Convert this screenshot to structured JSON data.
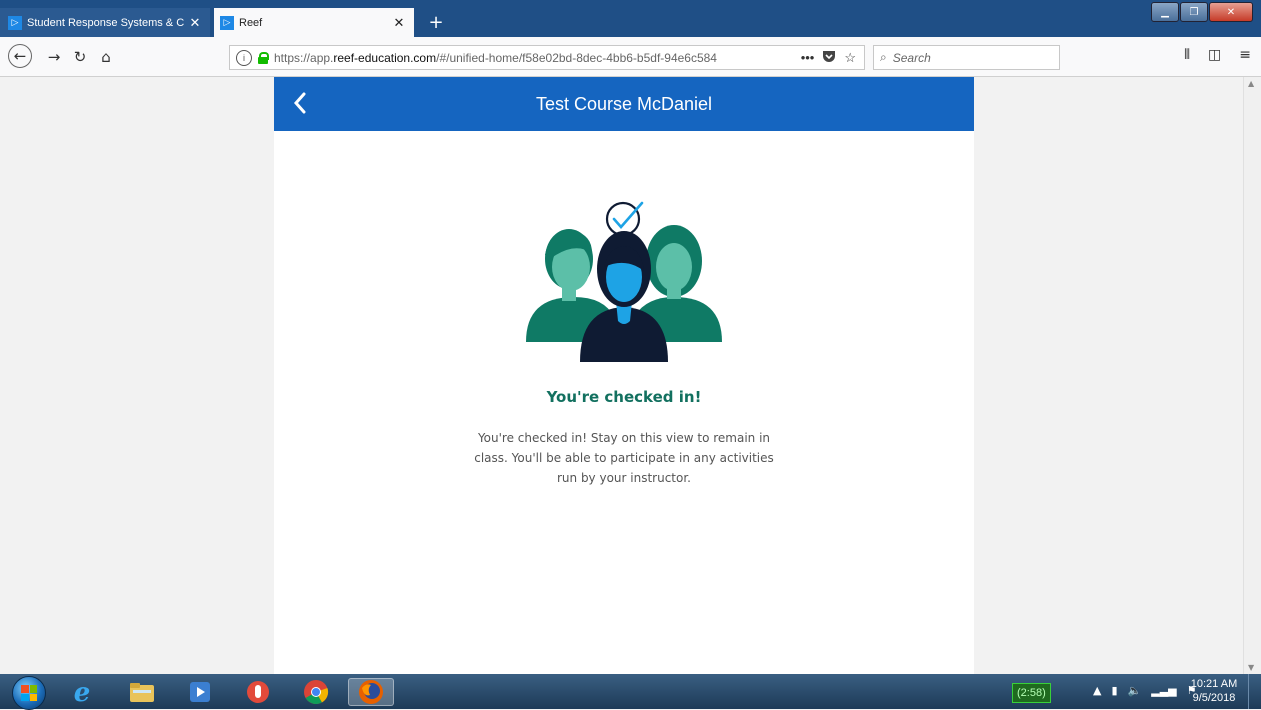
{
  "browser": {
    "tabs": [
      {
        "label": "Student Response Systems & C",
        "active": false
      },
      {
        "label": "Reef",
        "active": true
      }
    ],
    "url": {
      "prefix": "https://app.",
      "domain": "reef-education.com",
      "rest": "/#/unified-home/f58e02bd-8dec-4bb6-b5df-94e6c584"
    },
    "search_placeholder": "Search",
    "page_actions": "•••"
  },
  "course": {
    "title": "Test Course McDaniel"
  },
  "checkin": {
    "title": "You're checked in!",
    "description": "You're checked in! Stay on this view to remain in class. You'll be able to participate in any activities run by your instructor."
  },
  "taskbar": {
    "battery": "(2:58)",
    "time": "10:21 AM",
    "date": "9/5/2018"
  },
  "colors": {
    "header": "#1565c0",
    "accent_text": "#12705f",
    "teal": "#0f7a65",
    "teal_light": "#5cbfa8",
    "navy": "#0f1b33",
    "cyan": "#1ea3e5"
  }
}
